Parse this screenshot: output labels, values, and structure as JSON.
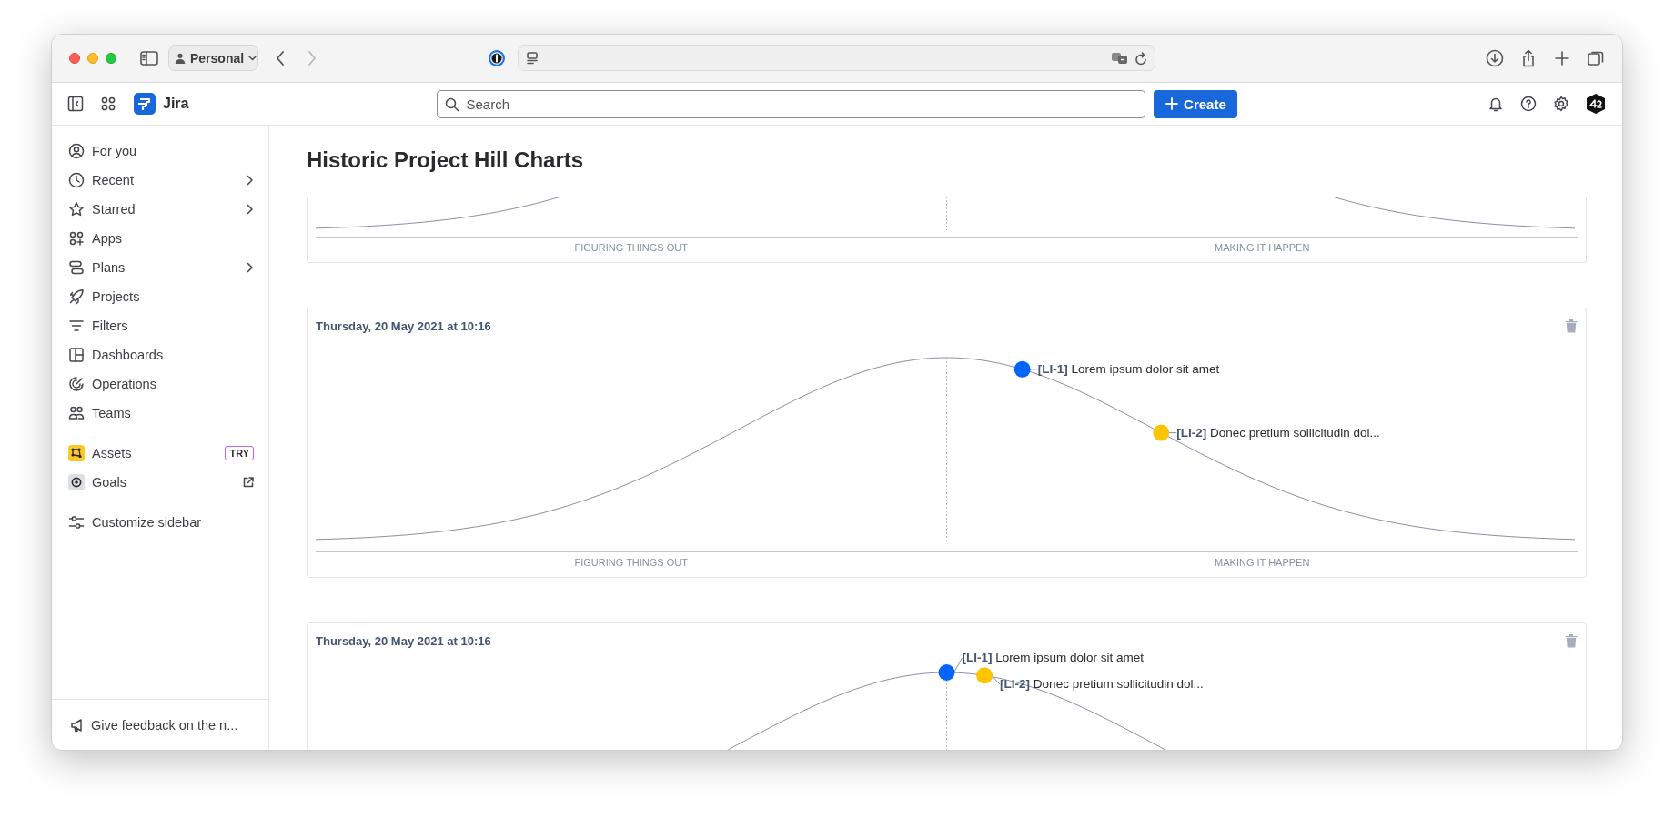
{
  "browser": {
    "profile": "Personal",
    "back": {
      "disabled": false
    },
    "forward": {
      "disabled": true
    }
  },
  "topbar": {
    "app_name": "Jira",
    "search": {
      "placeholder": "Search"
    },
    "create_button": "Create"
  },
  "sidebar": {
    "sections": [
      {
        "items": [
          {
            "label": "For you",
            "has_submenu": false
          },
          {
            "label": "Recent",
            "has_submenu": true
          },
          {
            "label": "Starred",
            "has_submenu": true
          },
          {
            "label": "Apps",
            "has_submenu": false
          },
          {
            "label": "Plans",
            "has_submenu": true
          },
          {
            "label": "Projects",
            "has_submenu": false
          },
          {
            "label": "Filters",
            "has_submenu": false
          },
          {
            "label": "Dashboards",
            "has_submenu": false
          },
          {
            "label": "Operations",
            "has_submenu": false
          },
          {
            "label": "Teams",
            "has_submenu": false
          }
        ]
      },
      {
        "items": [
          {
            "label": "Assets",
            "has_submenu": false,
            "badge": "TRY"
          },
          {
            "label": "Goals",
            "has_submenu": false,
            "external": true
          }
        ]
      },
      {
        "items": [
          {
            "label": "Customize sidebar",
            "has_submenu": false
          }
        ]
      }
    ],
    "feedback": "Give feedback on the n..."
  },
  "page": {
    "title": "Historic Project Hill Charts",
    "charts": [
      {
        "axis_labels": [
          "FIGURING THINGS OUT",
          "MAKING IT HAPPEN"
        ]
      },
      {
        "date": "Thursday, 20 May 2021 at 10:16",
        "axis_labels": [
          "FIGURING THINGS OUT",
          "MAKING IT HAPPEN"
        ],
        "points": [
          {
            "label": "**[LI-1]** Lorem ipsum dolor sit amet",
            "color": "#0065ff",
            "level": 0.56
          },
          {
            "label": "**[LI-2]** Donec pretium sollicitudin dol...",
            "color": "#ffc400",
            "level": 0.67
          }
        ]
      },
      {
        "date": "Thursday, 20 May 2021 at 10:16",
        "points": [
          {
            "label": "**[LI-1]** Lorem ipsum dolor sit amet",
            "color": "#0065ff",
            "level": 0.5
          },
          {
            "label": "**[LI-2]** Donec pretium sollicitudin dol...",
            "color": "#ffc400",
            "level": 0.53
          }
        ]
      }
    ]
  }
}
